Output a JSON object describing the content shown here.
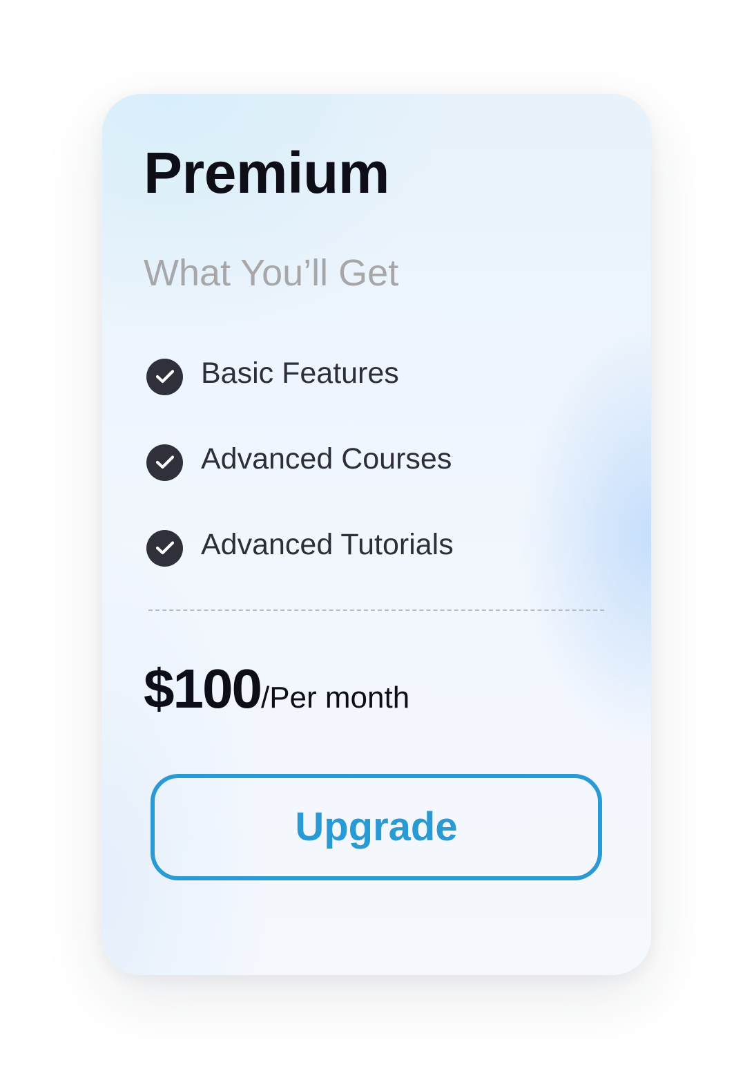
{
  "plan": {
    "title": "Premium",
    "subtitle": "What You’ll Get",
    "features": [
      {
        "label": "Basic Features",
        "icon": "check-circle-icon"
      },
      {
        "label": "Advanced Courses",
        "icon": "check-circle-icon"
      },
      {
        "label": "Advanced Tutorials",
        "icon": "check-circle-icon"
      }
    ],
    "price": {
      "amount": "$100",
      "period": "/Per month"
    },
    "button": {
      "label": "Upgrade"
    }
  },
  "colors": {
    "accent": "#2a9ad4",
    "text_dark": "#0d0e17",
    "text_muted": "#a7a7aa",
    "icon_bg": "#30303a"
  }
}
